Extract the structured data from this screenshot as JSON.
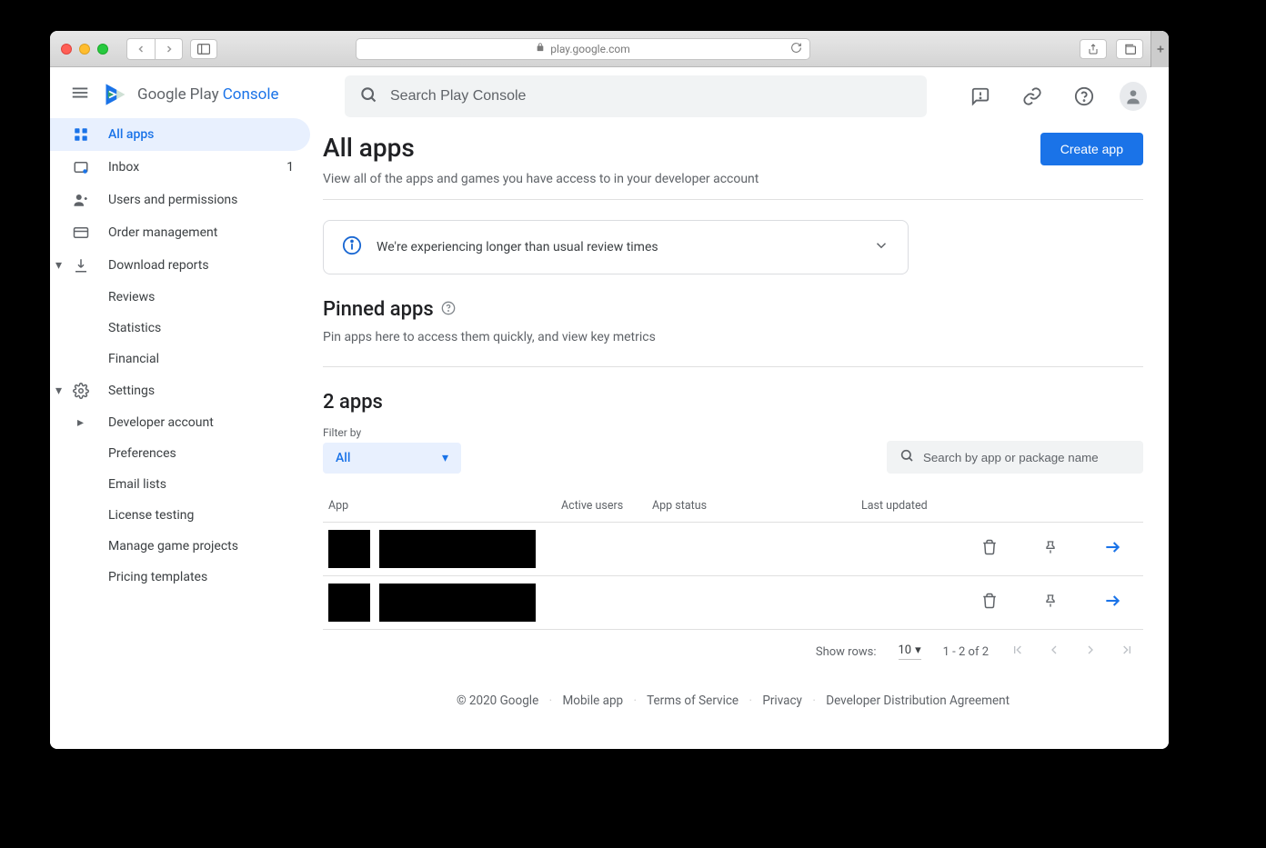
{
  "browser": {
    "url": "play.google.com"
  },
  "brand": {
    "google": "Google",
    "play": "Play",
    "console": "Console"
  },
  "search": {
    "placeholder": "Search Play Console"
  },
  "sidebar": {
    "items": [
      {
        "label": "All apps"
      },
      {
        "label": "Inbox",
        "badge": "1"
      },
      {
        "label": "Users and permissions"
      },
      {
        "label": "Order management"
      },
      {
        "label": "Download reports"
      },
      {
        "label": "Reviews"
      },
      {
        "label": "Statistics"
      },
      {
        "label": "Financial"
      },
      {
        "label": "Settings"
      },
      {
        "label": "Developer account"
      },
      {
        "label": "Preferences"
      },
      {
        "label": "Email lists"
      },
      {
        "label": "License testing"
      },
      {
        "label": "Manage game projects"
      },
      {
        "label": "Pricing templates"
      }
    ]
  },
  "page": {
    "title": "All apps",
    "subtitle": "View all of the apps and games you have access to in your developer account",
    "create_label": "Create app"
  },
  "alert": {
    "text": "We're experiencing longer than usual review times"
  },
  "pinned": {
    "title": "Pinned apps",
    "subtitle": "Pin apps here to access them quickly, and view key metrics"
  },
  "apps": {
    "title": "2 apps",
    "filter_label": "Filter by",
    "filter_value": "All",
    "search_placeholder": "Search by app or package name",
    "columns": {
      "app": "App",
      "active_users": "Active users",
      "status": "App status",
      "updated": "Last updated"
    }
  },
  "pager": {
    "show_rows": "Show rows:",
    "rows_value": "10",
    "range": "1 - 2 of 2"
  },
  "footer": {
    "copyright": "© 2020 Google",
    "links": [
      "Mobile app",
      "Terms of Service",
      "Privacy",
      "Developer Distribution Agreement"
    ]
  }
}
